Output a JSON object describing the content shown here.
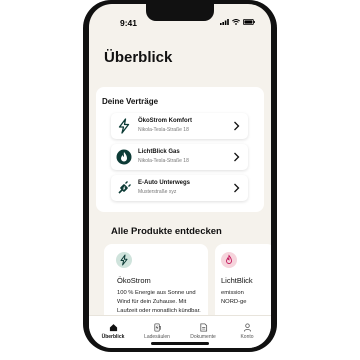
{
  "status_bar": {
    "time": "9:41"
  },
  "page": {
    "title": "Überblick"
  },
  "contracts": {
    "title": "Deine Verträge",
    "items": [
      {
        "name": "ÖkoStrom Komfort",
        "address": "Nikola-Tesla-Straße 18",
        "icon": "lightning-icon"
      },
      {
        "name": "LichtBlick Gas",
        "address": "Nikola-Tesla-Straße 18",
        "icon": "flame-icon"
      },
      {
        "name": "E-Auto Unterwegs",
        "address": "Musterstraße xyz",
        "icon": "charging-plug-icon"
      }
    ]
  },
  "products": {
    "title": "Alle Produkte entdecken",
    "items": [
      {
        "name": "ÖkoStrom",
        "description": "100 % Energie aus Sonne und Wind für dein Zuhause. Mit Laufzeit oder monatlich kündbar.",
        "icon": "lightning-icon",
        "icon_bg": "#cfe3dc"
      },
      {
        "name": "LichtBlick",
        "description": "emission NORD-ge",
        "icon": "flame-icon",
        "icon_bg": "#f6d4dc"
      }
    ]
  },
  "tabbar": {
    "items": [
      {
        "label": "Überblick",
        "icon": "home-icon",
        "active": true
      },
      {
        "label": "Ladesäulen",
        "icon": "charging-station-icon",
        "active": false
      },
      {
        "label": "Dokumente",
        "icon": "document-icon",
        "active": false
      },
      {
        "label": "Konto",
        "icon": "person-icon",
        "active": false
      }
    ]
  },
  "colors": {
    "accent_dark": "#0d3b36",
    "background": "#f5f2ec"
  }
}
